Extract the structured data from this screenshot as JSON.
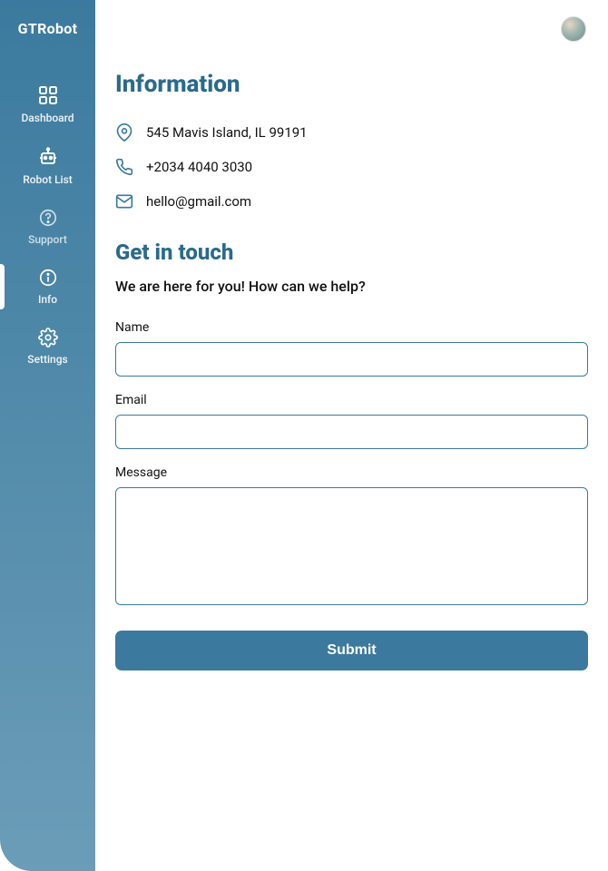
{
  "brand": "GTRobot",
  "sidebar": {
    "items": [
      {
        "label": "Dashboard"
      },
      {
        "label": "Robot List"
      },
      {
        "label": "Support"
      },
      {
        "label": "Info"
      },
      {
        "label": "Settings"
      }
    ]
  },
  "info": {
    "title": "Information",
    "address": "545 Mavis Island, IL 99191",
    "phone": "+2034 4040 3030",
    "email": "hello@gmail.com"
  },
  "contact": {
    "title": "Get in touch",
    "subtitle": "We are here for you! How can we help?",
    "name_label": "Name",
    "email_label": "Email",
    "message_label": "Message",
    "submit_label": "Submit",
    "name_value": "",
    "email_value": "",
    "message_value": ""
  },
  "colors": {
    "primary": "#3b7a9e",
    "title": "#2a6a8b"
  }
}
